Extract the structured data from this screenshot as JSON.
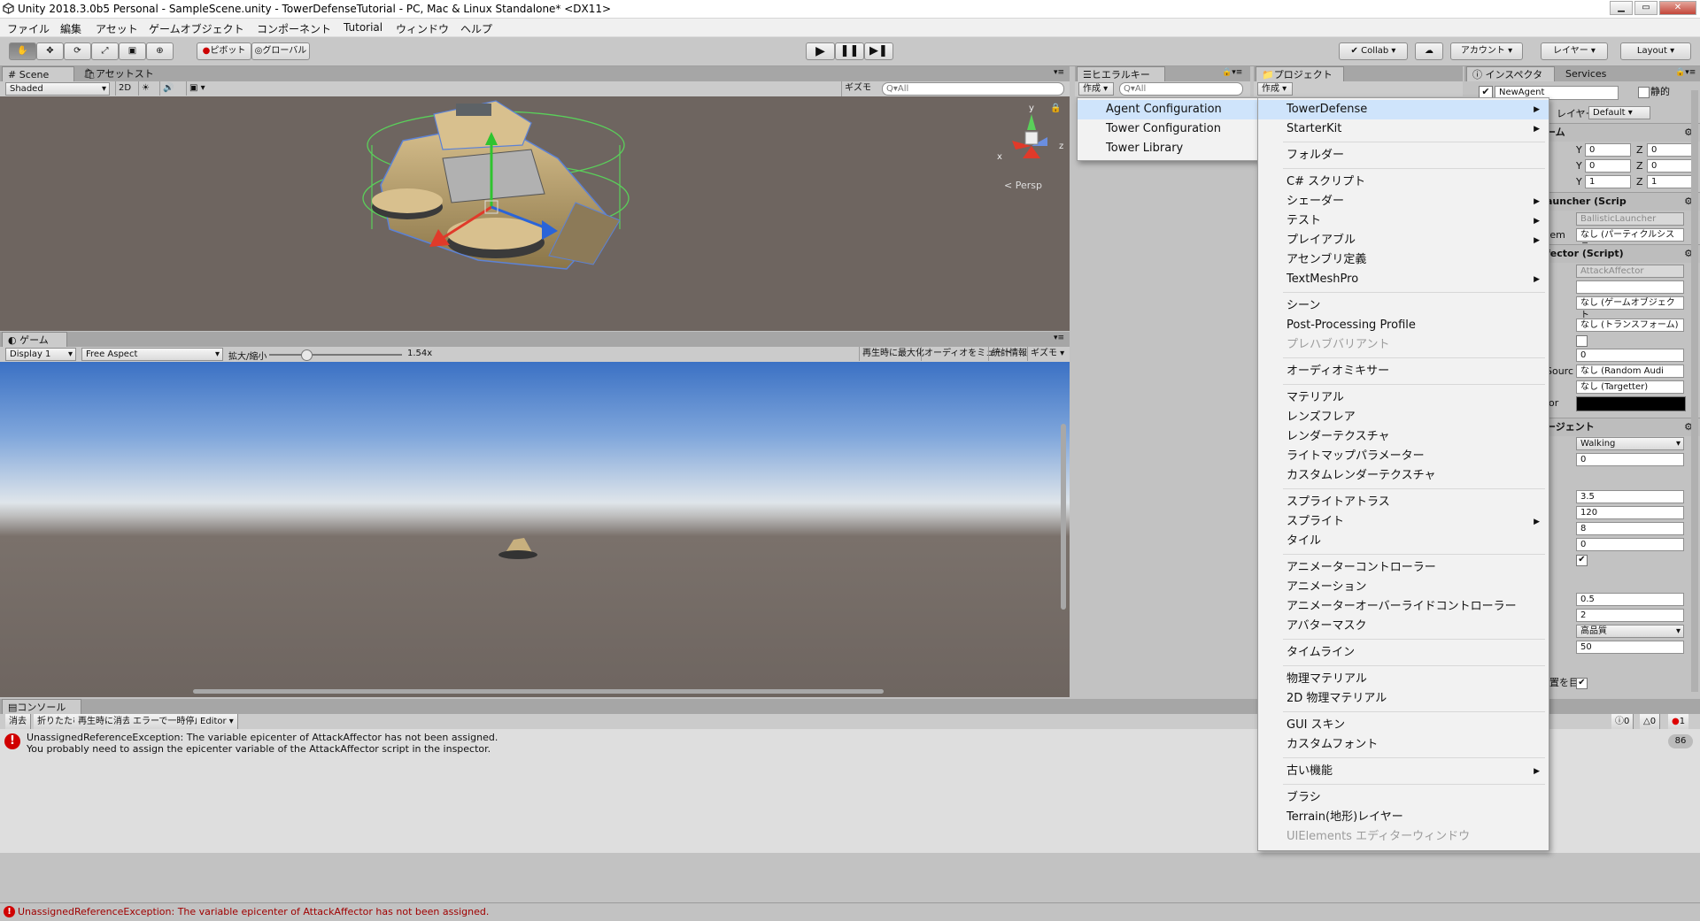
{
  "window": {
    "title": "Unity 2018.3.0b5 Personal - SampleScene.unity - TowerDefenseTutorial - PC, Mac & Linux Standalone* <DX11>"
  },
  "menubar": {
    "items": [
      "ファイル",
      "編集",
      "アセット",
      "ゲームオブジェクト",
      "コンポーネント",
      "Tutorial",
      "ウィンドウ",
      "ヘルプ"
    ]
  },
  "toolbar": {
    "pivot": "ピボット",
    "global": "グローバル",
    "collab": "Collab",
    "account": "アカウント",
    "layers": "レイヤー",
    "layout": "Layout"
  },
  "scene": {
    "tab_scene": "Scene",
    "tab_store": "アセットストア",
    "shading": "Shaded",
    "mode_2d": "2D",
    "gizmos": "ギズモ",
    "search": "Q▾All",
    "persp": "< Persp",
    "axis_x": "x",
    "axis_y": "y",
    "axis_z": "z"
  },
  "game": {
    "tab": "ゲーム",
    "display": "Display 1",
    "aspect": "Free Aspect",
    "scale_label": "拡大/縮小",
    "scale_value": "1.54x",
    "btn_maximize": "再生時に最大化",
    "btn_mute": "オーディオをミュート",
    "btn_stats": "統計情報",
    "btn_gizmos": "ギズモ"
  },
  "hierarchy": {
    "tab": "ヒエラルキー",
    "create": "作成",
    "search": "Q▾All"
  },
  "project": {
    "tab": "プロジェクト",
    "create": "作成"
  },
  "submenu": {
    "items": [
      "Agent Configuration",
      "Tower Configuration",
      "Tower Library"
    ]
  },
  "create_menu": {
    "items": [
      {
        "label": "TowerDefense",
        "arrow": true,
        "hl": true
      },
      {
        "label": "StarterKit",
        "arrow": true
      },
      {
        "sep": true
      },
      {
        "label": "フォルダー"
      },
      {
        "sep": true
      },
      {
        "label": "C# スクリプト"
      },
      {
        "label": "シェーダー",
        "arrow": true
      },
      {
        "label": "テスト",
        "arrow": true
      },
      {
        "label": "プレイアブル",
        "arrow": true
      },
      {
        "label": "アセンブリ定義"
      },
      {
        "label": "TextMeshPro",
        "arrow": true
      },
      {
        "sep": true
      },
      {
        "label": "シーン"
      },
      {
        "label": "Post-Processing Profile"
      },
      {
        "label": "プレハブバリアント",
        "dis": true
      },
      {
        "sep": true
      },
      {
        "label": "オーディオミキサー"
      },
      {
        "sep": true
      },
      {
        "label": "マテリアル"
      },
      {
        "label": "レンズフレア"
      },
      {
        "label": "レンダーテクスチャ"
      },
      {
        "label": "ライトマップパラメーター"
      },
      {
        "label": "カスタムレンダーテクスチャ"
      },
      {
        "sep": true
      },
      {
        "label": "スプライトアトラス"
      },
      {
        "label": "スプライト",
        "arrow": true
      },
      {
        "label": "タイル"
      },
      {
        "sep": true
      },
      {
        "label": "アニメーターコントローラー"
      },
      {
        "label": "アニメーション"
      },
      {
        "label": "アニメーターオーバーライドコントローラー"
      },
      {
        "label": "アバターマスク"
      },
      {
        "sep": true
      },
      {
        "label": "タイムライン"
      },
      {
        "sep": true
      },
      {
        "label": "物理マテリアル"
      },
      {
        "label": "2D 物理マテリアル"
      },
      {
        "sep": true
      },
      {
        "label": "GUI スキン"
      },
      {
        "label": "カスタムフォント"
      },
      {
        "sep": true
      },
      {
        "label": "古い機能",
        "arrow": true
      },
      {
        "sep": true
      },
      {
        "label": "ブラシ"
      },
      {
        "label": "Terrain(地形)レイヤー"
      },
      {
        "label": "UIElements エディターウィンドウ",
        "dis": true
      }
    ]
  },
  "inspector": {
    "tab": "インスペクター",
    "tab_services": "Services",
    "object_name": "NewAgent",
    "static": "静的",
    "layer_label": "レイヤー",
    "layer_value": "Default",
    "transform_header": "ーム",
    "pos_y": "0",
    "pos_z": "0",
    "rot_y": "0",
    "rot_z": "0",
    "scale_y": "1",
    "scale_z": "1",
    "y": "Y",
    "z": "Z",
    "launcher_header": "auncher (Scrip",
    "launcher_script": "BallisticLauncher",
    "launcher_label": "tem",
    "launcher_value": "なし (パーティクルシステ",
    "affector_header": "fector (Script)",
    "affector_script": "AttackAffector",
    "affector_go": "なし (ゲームオブジェクト",
    "affector_transform": "なし (トランスフォーム)",
    "affector_zero": "0",
    "source_label": "Sourc",
    "source_value": "なし (Random Audi",
    "targetter_value": "なし (Targetter)",
    "color_label": "lor",
    "agent_header": "ージェント",
    "walking": "Walking",
    "v0": "0",
    "v1": "3.5",
    "v2": "120",
    "v3": "8",
    "v4": "0",
    "v5": "0.5",
    "v6": "2",
    "quality": "高品質",
    "v7": "50",
    "bottom_label": "置を目"
  },
  "console": {
    "tab": "コンソール",
    "btn_clear": "消去",
    "btn_collapse": "折りたたむ",
    "btn_clear_play": "再生時に消去",
    "btn_error_pause": "エラーで一時停止",
    "btn_editor": "Editor",
    "msg1": "UnassignedReferenceException: The variable epicenter of AttackAffector has not been assigned.",
    "msg2": "You probably need to assign the epicenter variable of the AttackAffector script in the inspector.",
    "count_info": "0",
    "count_warn": "0",
    "count_err": "1",
    "badge": "86"
  },
  "status": {
    "text": "UnassignedReferenceException: The variable epicenter of AttackAffector has not been assigned."
  },
  "colors": {
    "accent": "#cfe4fb",
    "error": "#d00000"
  }
}
